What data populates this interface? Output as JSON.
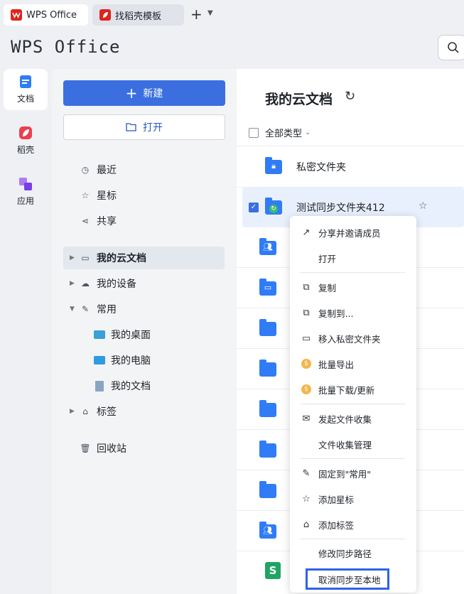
{
  "tabs": [
    {
      "label": "WPS Office",
      "color": "#e0231b"
    },
    {
      "label": "找稻壳模板",
      "color": "#e0231b"
    }
  ],
  "logo": "WPS Office",
  "rail": [
    {
      "label": "文档",
      "icon": "document-icon",
      "color": "#2f7cf6"
    },
    {
      "label": "稻壳",
      "icon": "daoke-icon",
      "color": "#e8404f"
    },
    {
      "label": "应用",
      "icon": "apps-icon",
      "color": "#8a4cf0"
    }
  ],
  "nav": {
    "new_label": "新建",
    "open_label": "打开",
    "items": [
      "最近",
      "星标",
      "共享"
    ],
    "tree": [
      "我的云文档",
      "我的设备",
      "常用"
    ],
    "common": [
      "我的桌面",
      "我的电脑",
      "我的文档"
    ],
    "tags": "标签",
    "trash": "回收站"
  },
  "main": {
    "title": "我的云文档",
    "filter": "全部类型",
    "rows": [
      "私密文件夹",
      "测试同步文件夹412"
    ]
  },
  "menu": {
    "items": [
      "分享并邀请成员",
      "打开",
      "复制",
      "复制到...",
      "移入私密文件夹",
      "批量导出",
      "批量下载/更新",
      "发起文件收集",
      "文件收集管理",
      "固定到\"常用\"",
      "添加星标",
      "添加标签",
      "修改同步路径",
      "取消同步至本地"
    ]
  },
  "colors": {
    "accent": "#3b6fe0",
    "folder": "#2f7cf6",
    "highlight": "#2f62e8"
  }
}
